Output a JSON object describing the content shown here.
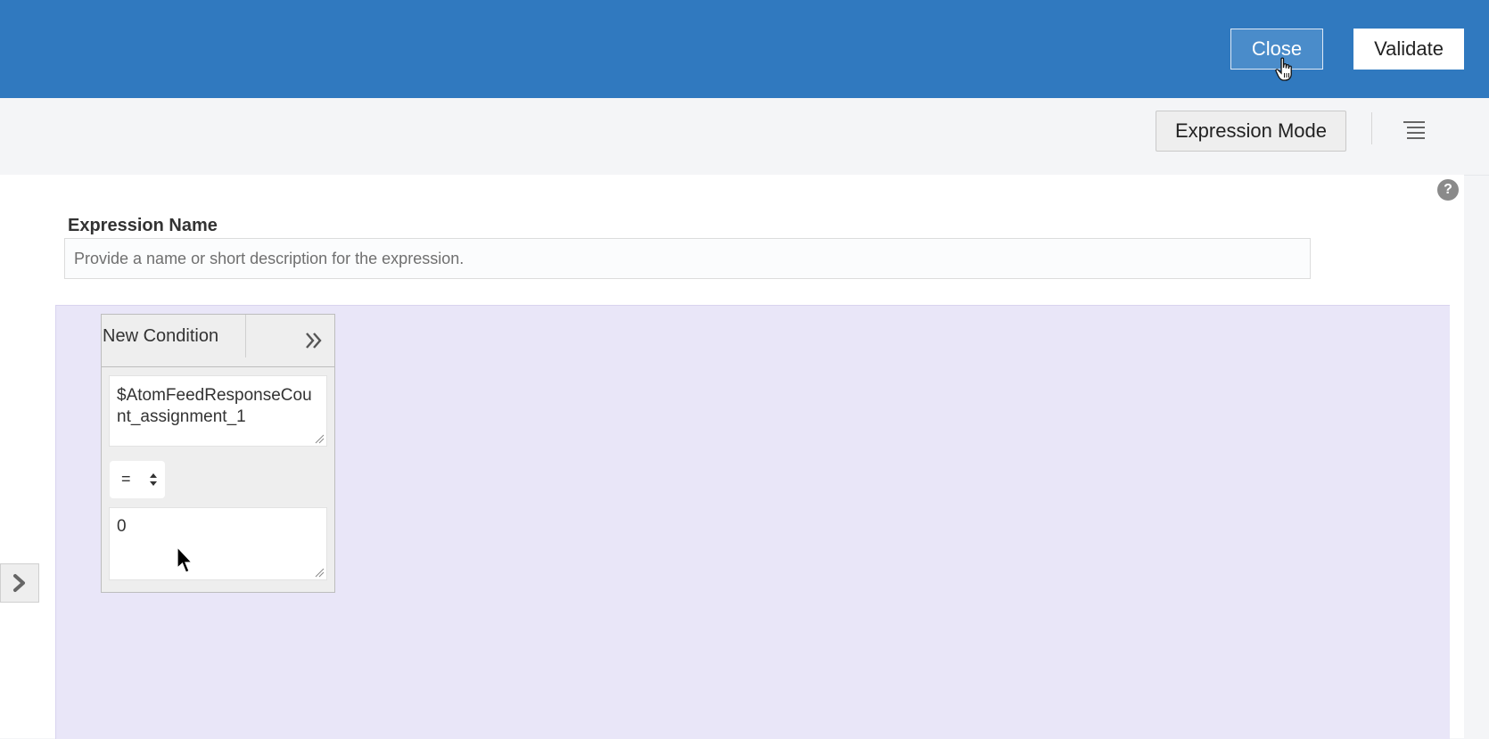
{
  "header": {
    "close_label": "Close",
    "validate_label": "Validate",
    "background_color": "#3079bf"
  },
  "toolbar": {
    "mode_label": "Expression Mode",
    "menu_icon": "hamburger-menu-icon"
  },
  "expression": {
    "name_label": "Expression Name",
    "name_placeholder": "Provide a name or short description for the expression.",
    "name_value": ""
  },
  "condition": {
    "title": "New Condition",
    "left_operand": "$AtomFeedResponseCount_assignment_1",
    "operator": "=",
    "right_operand": "0"
  },
  "canvas": {
    "background_color": "#e9e6f8"
  },
  "icons": {
    "help": "help-icon",
    "expand_panel": "chevron-right-icon",
    "expand_condition": "double-chevron-right-icon"
  }
}
